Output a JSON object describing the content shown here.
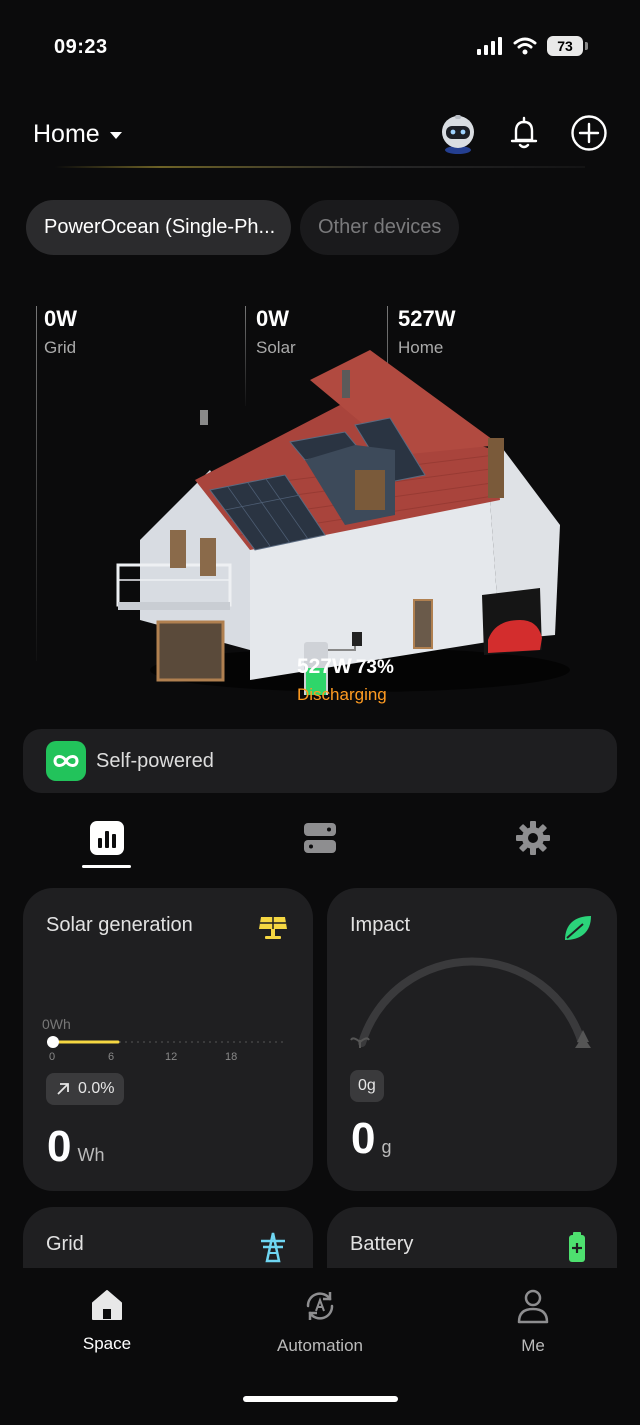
{
  "status_bar": {
    "time": "09:23",
    "battery_level": "73"
  },
  "header": {
    "title": "Home"
  },
  "devices": {
    "active": "PowerOcean (Single-Ph...",
    "inactive": "Other devices"
  },
  "energy": {
    "grid": {
      "value": "0W",
      "label": "Grid"
    },
    "solar": {
      "value": "0W",
      "label": "Solar"
    },
    "home": {
      "value": "527W",
      "label": "Home"
    },
    "battery": {
      "power": "527W",
      "percent": "73%",
      "state": "Discharging"
    }
  },
  "mode": {
    "label": "Self-powered"
  },
  "cards": {
    "solar": {
      "title": "Solar generation",
      "axis_label": "0Wh",
      "ticks": [
        "0",
        "6",
        "12",
        "18"
      ],
      "progress_fraction": 0.28,
      "change": "0.0%",
      "value": "0",
      "unit": "Wh"
    },
    "impact": {
      "title": "Impact",
      "badge": "0g",
      "value": "0",
      "unit": "g"
    },
    "grid": {
      "title": "Grid"
    },
    "battery": {
      "title": "Battery"
    }
  },
  "nav": {
    "space": "Space",
    "automation": "Automation",
    "me": "Me"
  },
  "colors": {
    "accent_green": "#22c35b",
    "discharging": "#ff9b21",
    "solar_yellow": "#f5d742",
    "grid_blue": "#6fd6f2"
  }
}
